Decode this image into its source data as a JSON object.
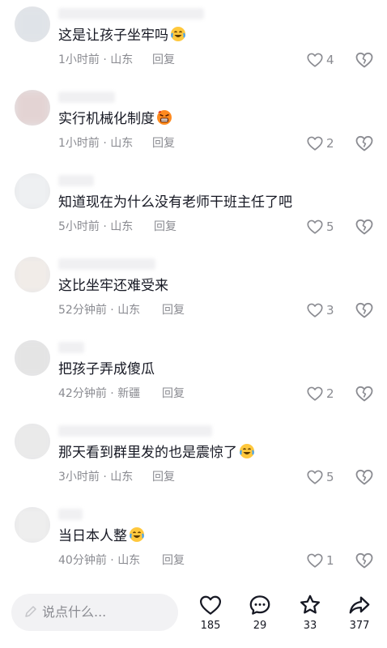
{
  "comments": [
    {
      "text": "这是让孩子坐牢吗",
      "emoji": "crying-laughing-emoji",
      "time": "1小时前",
      "location": "山东",
      "reply_label": "回复",
      "likes": "4"
    },
    {
      "text": "实行机械化制度",
      "emoji": "angry-emoji",
      "time": "1小时前",
      "location": "山东",
      "reply_label": "回复",
      "likes": "2"
    },
    {
      "text": "知道现在为什么没有老师干班主任了吧",
      "emoji": "",
      "time": "5小时前",
      "location": "山东",
      "reply_label": "回复",
      "likes": "5"
    },
    {
      "text": "这比坐牢还难受来",
      "emoji": "",
      "time": "52分钟前",
      "location": "山东",
      "reply_label": "回复",
      "likes": "3"
    },
    {
      "text": "把孩子弄成傻瓜",
      "emoji": "",
      "time": "42分钟前",
      "location": "新疆",
      "reply_label": "回复",
      "likes": "2"
    },
    {
      "text": "那天看到群里发的也是震惊了",
      "emoji": "crying-laughing-emoji",
      "time": "3小时前",
      "location": "山东",
      "reply_label": "回复",
      "likes": "5"
    },
    {
      "text": "当日本人整",
      "emoji": "crying-laughing-emoji",
      "time": "40分钟前",
      "location": "山东",
      "reply_label": "回复",
      "likes": "1"
    }
  ],
  "input": {
    "placeholder": "说点什么..."
  },
  "actions": {
    "likes": "185",
    "comments": "29",
    "favorites": "33",
    "shares": "377"
  },
  "colors": {
    "text": "#161823",
    "meta": "#8a8b91",
    "icon": "#8a8b91",
    "background": "#ffffff",
    "input_bg": "#f2f2f4"
  }
}
